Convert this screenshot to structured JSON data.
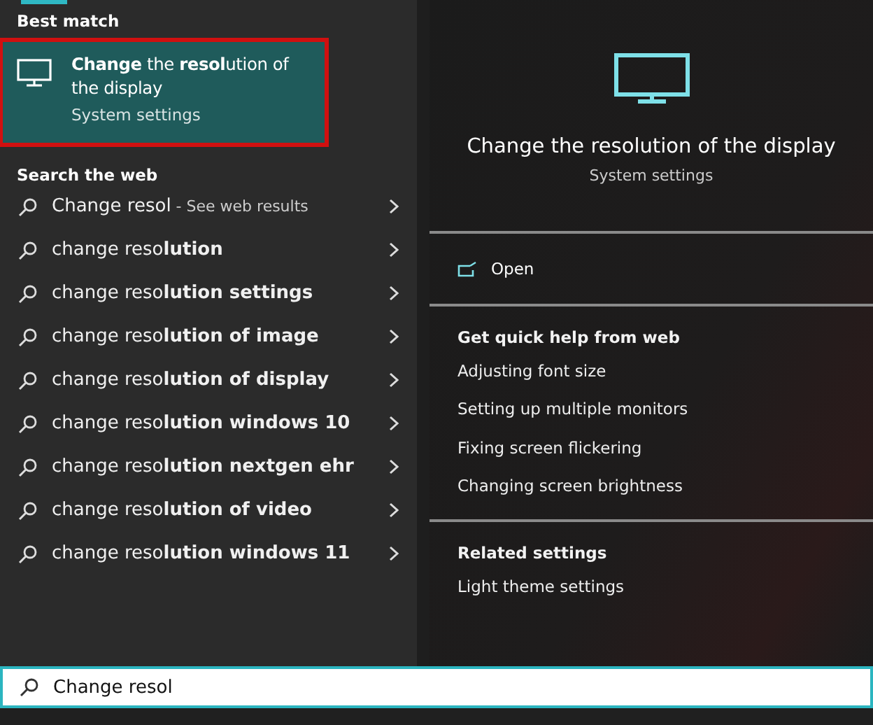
{
  "best_match": {
    "heading": "Best match",
    "title": "**Change** the **resol**ution of the display",
    "subtitle": "System settings",
    "selected": true,
    "outlined": true
  },
  "web": {
    "heading": "Search the web",
    "items": [
      {
        "text": "Change resol",
        "note": "- See web results"
      },
      {
        "text": "change reso**lution**"
      },
      {
        "text": "change reso**lution settings**"
      },
      {
        "text": "change reso**lution of image**"
      },
      {
        "text": "change reso**lution of display**"
      },
      {
        "text": "change reso**lution windows 10**"
      },
      {
        "text": "change reso**lution nextgen ehr**"
      },
      {
        "text": "change reso**lution of video**"
      },
      {
        "text": "change reso**lution windows 11**"
      }
    ]
  },
  "preview": {
    "title": "Change the resolution of the display",
    "subtitle": "System settings",
    "action": "Open",
    "sections": [
      {
        "heading": "Get quick help from web",
        "items": [
          "Adjusting font size",
          "Setting up multiple monitors",
          "Fixing screen flickering",
          "Changing screen brightness"
        ]
      },
      {
        "heading": "Related settings",
        "items": [
          "Light theme settings"
        ]
      }
    ]
  },
  "search": {
    "value": "Change resol"
  }
}
